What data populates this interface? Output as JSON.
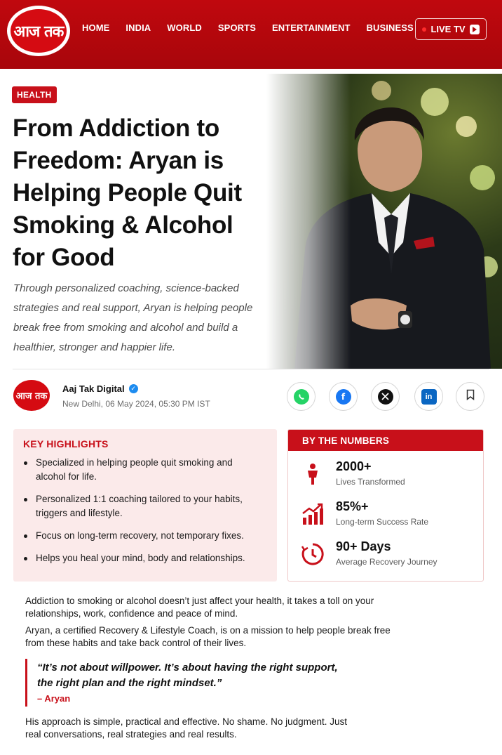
{
  "header": {
    "logo_text": "आज तक",
    "nav": [
      "HOME",
      "INDIA",
      "WORLD",
      "SPORTS",
      "ENTERTAINMENT",
      "BUSINESS"
    ],
    "live_label": "LIVE TV"
  },
  "article": {
    "category": "HEALTH",
    "headline": "From Addiction to Freedom: Aryan is Helping People Quit Smoking & Alcohol for Good",
    "subtitle": "Through personalized coaching, science-backed strategies and real support, Aryan is helping people break free from smoking and alcohol and build a healthier, stronger and happier life."
  },
  "author": {
    "logo_text": "आज तक",
    "name": "Aaj Tak Digital",
    "meta": "New Delhi, 06 May 2024, 05:30 PM IST"
  },
  "share": [
    {
      "name": "whatsapp",
      "color": "#25d366"
    },
    {
      "name": "facebook",
      "color": "#1877f2"
    },
    {
      "name": "x",
      "color": "#111111"
    },
    {
      "name": "linkedin",
      "color": "#0a66c2"
    },
    {
      "name": "bookmark",
      "color": "#333333"
    }
  ],
  "highlights": {
    "title": "KEY HIGHLIGHTS",
    "items": [
      "Specialized in helping people quit smoking and alcohol for life.",
      "Personalized 1:1 coaching tailored to your habits, triggers and lifestyle.",
      "Focus on long-term recovery, not temporary fixes.",
      "Helps you heal your mind, body and relationships."
    ]
  },
  "numbers": {
    "title": "BY THE NUMBERS",
    "stats": [
      {
        "value": "2000+",
        "label": "Lives Transformed",
        "icon": "person-icon"
      },
      {
        "value": "85%+",
        "label": "Long-term Success Rate",
        "icon": "growth-chart-icon"
      },
      {
        "value": "90+ Days",
        "label": "Average Recovery Journey",
        "icon": "clock-icon"
      }
    ]
  },
  "body": {
    "p1": "Addiction to smoking or alcohol doesn’t just affect your health, it takes a toll on your relationships, work, confidence and peace of mind.",
    "p2": "Aryan, a certified Recovery & Lifestyle Coach, is on a mission to help people break free from these habits and take back control of their lives.",
    "quote": "“It’s not about willpower. It’s about having the right support, the right plan and the right mindset.”",
    "quote_author": "– Aryan",
    "p3": "His approach is simple, practical and effective. No shame. No judgment. Just real conversations, real strategies and real results."
  },
  "colors": {
    "brand_red": "#c8101a",
    "header_red": "#b5070c",
    "highlight_bg": "#fbeaea"
  }
}
